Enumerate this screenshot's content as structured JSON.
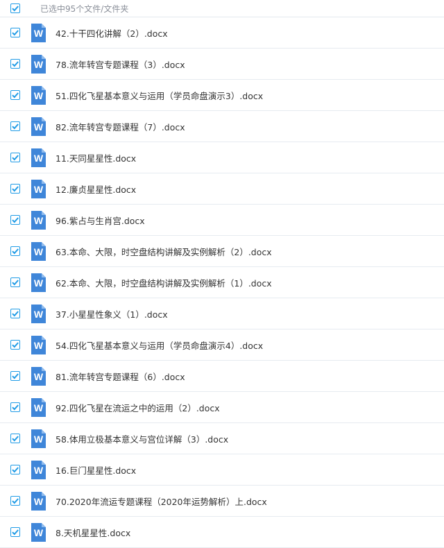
{
  "header": {
    "selected_label": "已选中95个文件/文件夹",
    "checked": true
  },
  "colors": {
    "accent": "#1f9be6",
    "word_icon": "#3f86d9"
  },
  "file_icon": {
    "name": "word-doc-icon",
    "letter": "W"
  },
  "files": [
    {
      "name": "42.十干四化讲解（2）.docx",
      "checked": true
    },
    {
      "name": "78.流年转宫专题课程（3）.docx",
      "checked": true
    },
    {
      "name": "51.四化飞星基本意义与运用（学员命盘演示3）.docx",
      "checked": true
    },
    {
      "name": "82.流年转宫专题课程（7）.docx",
      "checked": true
    },
    {
      "name": "11.天同星星性.docx",
      "checked": true
    },
    {
      "name": "12.廉贞星星性.docx",
      "checked": true
    },
    {
      "name": "96.紫占与生肖宫.docx",
      "checked": true
    },
    {
      "name": "63.本命、大限，时空盘结构讲解及实例解析（2）.docx",
      "checked": true
    },
    {
      "name": "62.本命、大限，时空盘结构讲解及实例解析（1）.docx",
      "checked": true
    },
    {
      "name": "37.小星星性象义（1）.docx",
      "checked": true
    },
    {
      "name": "54.四化飞星基本意义与运用（学员命盘演示4）.docx",
      "checked": true
    },
    {
      "name": "81.流年转宫专题课程（6）.docx",
      "checked": true
    },
    {
      "name": "92.四化飞星在流运之中的运用（2）.docx",
      "checked": true
    },
    {
      "name": "58.体用立极基本意义与宫位详解（3）.docx",
      "checked": true
    },
    {
      "name": "16.巨门星星性.docx",
      "checked": true
    },
    {
      "name": "70.2020年流运专题课程（2020年运势解析）上.docx",
      "checked": true
    },
    {
      "name": "8.天机星星性.docx",
      "checked": true
    }
  ]
}
